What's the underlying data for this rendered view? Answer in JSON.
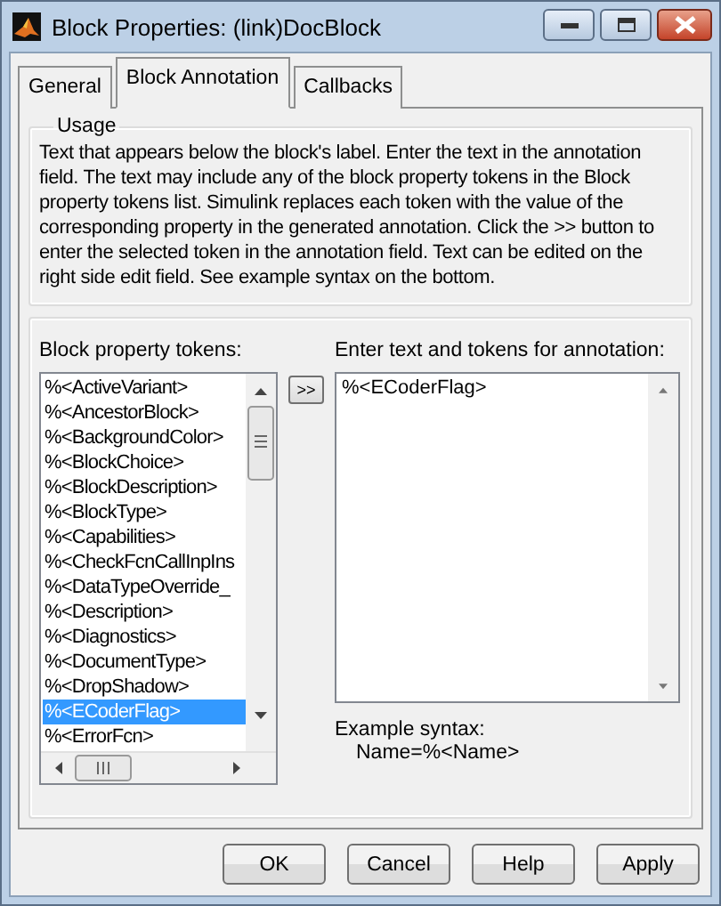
{
  "window": {
    "title": "Block Properties: (link)DocBlock"
  },
  "tabs": [
    {
      "label": "General",
      "selected": false
    },
    {
      "label": "Block Annotation",
      "selected": true
    },
    {
      "label": "Callbacks",
      "selected": false
    }
  ],
  "usage": {
    "title": "Usage",
    "text": "Text that appears below the block's label. Enter the text in the annotation field. The text may include any of the block property tokens in the Block property tokens list. Simulink replaces each token with the value of the corresponding property in the generated annotation. Click the >> button to enter the selected token in the annotation field. Text can be edited on the right side edit field. See example syntax on the bottom."
  },
  "tokens": {
    "label": "Block property tokens:",
    "items": [
      {
        "text": "%<ActiveVariant>",
        "selected": false
      },
      {
        "text": "%<AncestorBlock>",
        "selected": false
      },
      {
        "text": "%<BackgroundColor>",
        "selected": false
      },
      {
        "text": "%<BlockChoice>",
        "selected": false
      },
      {
        "text": "%<BlockDescription>",
        "selected": false
      },
      {
        "text": "%<BlockType>",
        "selected": false
      },
      {
        "text": "%<Capabilities>",
        "selected": false
      },
      {
        "text": "%<CheckFcnCallInpIns",
        "selected": false
      },
      {
        "text": "%<DataTypeOverride_",
        "selected": false
      },
      {
        "text": "%<Description>",
        "selected": false
      },
      {
        "text": "%<Diagnostics>",
        "selected": false
      },
      {
        "text": "%<DocumentType>",
        "selected": false
      },
      {
        "text": "%<DropShadow>",
        "selected": false
      },
      {
        "text": "%<ECoderFlag>",
        "selected": true
      },
      {
        "text": "%<ErrorFcn>",
        "selected": false
      }
    ]
  },
  "add_button": ">>",
  "annotation": {
    "label": "Enter text and tokens for annotation:",
    "value": "%<ECoderFlag>"
  },
  "example": {
    "label": "Example syntax:",
    "syntax": "Name=%<Name>"
  },
  "buttons": [
    "OK",
    "Cancel",
    "Help",
    "Apply"
  ]
}
